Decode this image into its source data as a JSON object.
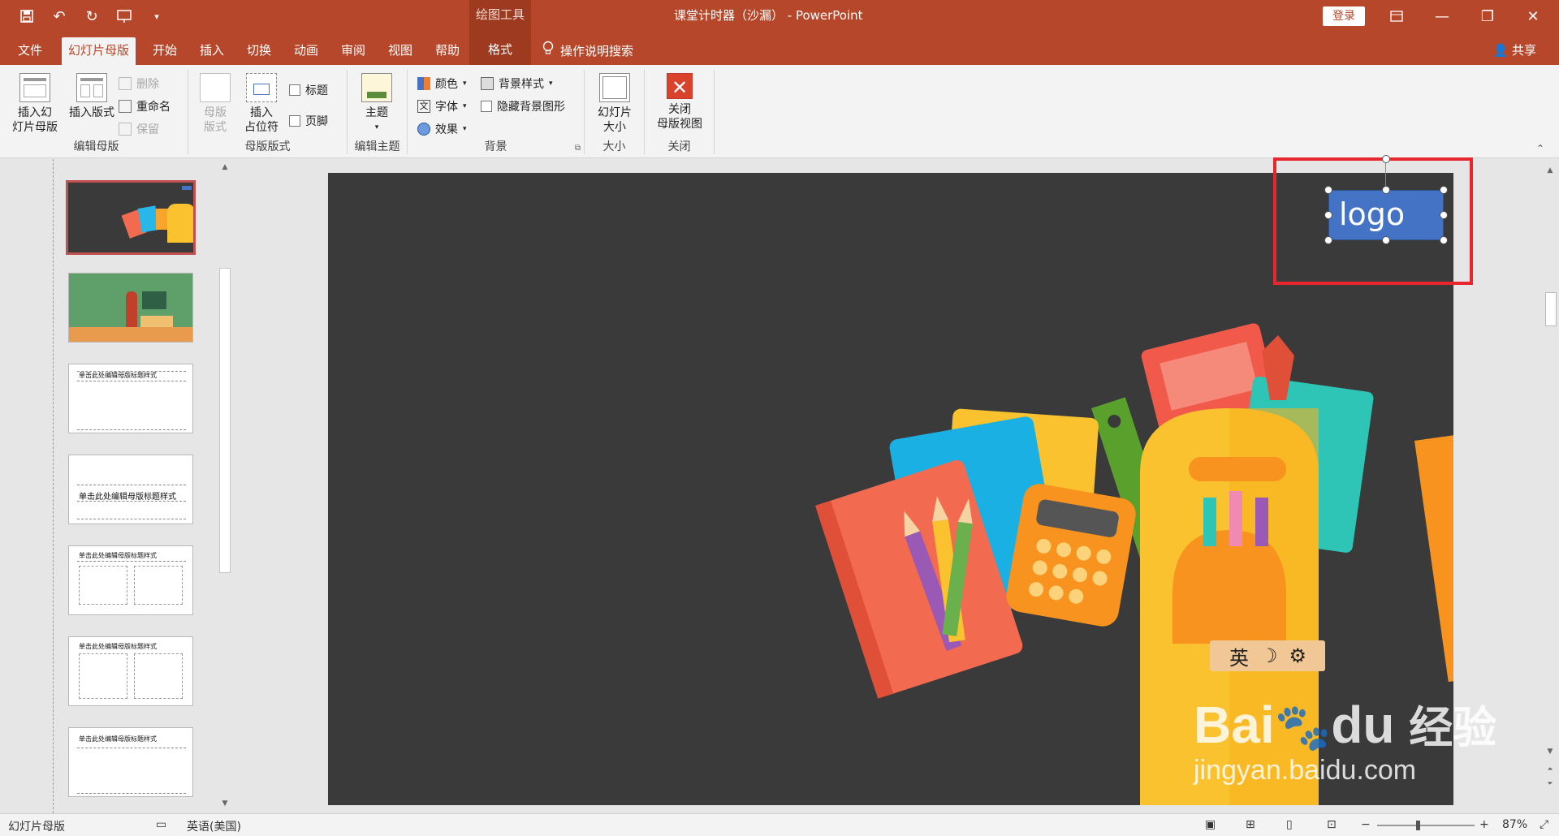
{
  "app": {
    "title": "课堂计时器（沙漏） - PowerPoint",
    "login": "登录",
    "context_tab": "绘图工具"
  },
  "tabs": [
    "文件",
    "幻灯片母版",
    "开始",
    "插入",
    "切换",
    "动画",
    "审阅",
    "视图",
    "帮助",
    "格式"
  ],
  "active_tab": "幻灯片母版",
  "search_label": "操作说明搜索",
  "share_label": "共享",
  "ribbon": {
    "edit_master": {
      "label": "编辑母版",
      "insert_master": "插入幻\n灯片母版",
      "insert_layout": "插入版式",
      "delete": "删除",
      "rename": "重命名",
      "preserve": "保留"
    },
    "master_layout": {
      "label": "母版版式",
      "master_layout_btn": "母版\n版式",
      "insert_placeholder": "插入\n占位符",
      "title_cb": "标题",
      "footer_cb": "页脚"
    },
    "edit_theme": {
      "label": "编辑主题",
      "theme": "主题"
    },
    "background": {
      "label": "背景",
      "colors": "颜色",
      "fonts": "字体",
      "effects": "效果",
      "bg_styles": "背景样式",
      "hide_bg": "隐藏背景图形"
    },
    "size": {
      "label": "大小",
      "slide_size": "幻灯片\n大小"
    },
    "close": {
      "label": "关闭",
      "close_master": "关闭\n母版视图"
    }
  },
  "thumbnails": {
    "layout_title": "单击此处编辑母版标题样式"
  },
  "slide": {
    "logo_text": "logo"
  },
  "ime": {
    "lang": "英"
  },
  "watermark": {
    "brand": "Bai",
    "brand2": "du",
    "suffix": "经验",
    "url": "jingyan.baidu.com"
  },
  "status": {
    "view": "幻灯片母版",
    "language": "英语(美国)",
    "zoom": "87%"
  },
  "colors": {
    "accent": "#b7472a",
    "slide_bg": "#3a3a3a",
    "logo_fill": "#4472c4",
    "highlight": "#e8262e"
  }
}
